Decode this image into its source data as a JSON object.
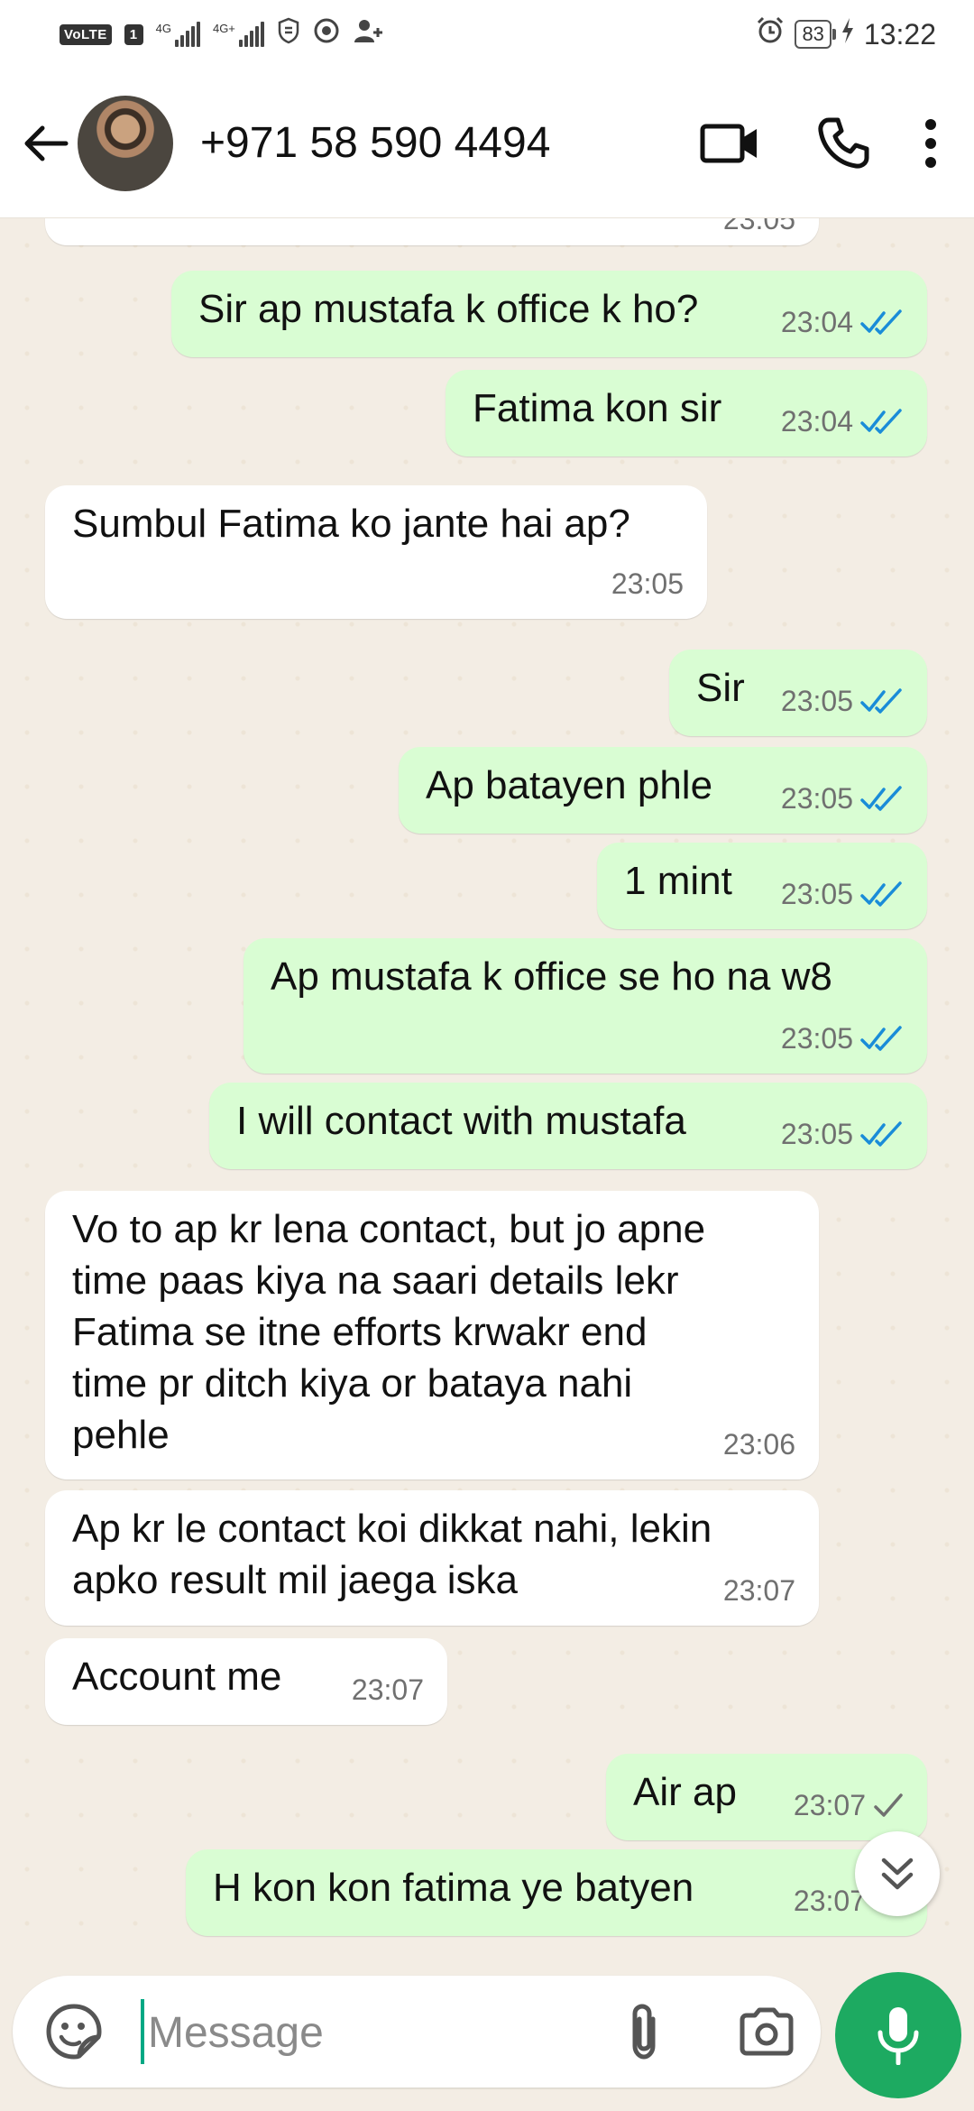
{
  "status_bar": {
    "volte": "VoLTE",
    "sim1_label": "1",
    "net1": "4G",
    "net2": "4G+",
    "battery": "83",
    "time": "13:22"
  },
  "header": {
    "contact": "+971 58 590 4494",
    "icons": [
      "back-arrow-icon",
      "avatar",
      "video-call-icon",
      "phone-icon",
      "more-vert-icon"
    ]
  },
  "messages": [
    {
      "dir": "in",
      "text": "",
      "time": "23:05",
      "status": ""
    },
    {
      "dir": "out",
      "text": "Sir ap mustafa k office k ho?",
      "time": "23:04",
      "status": "read"
    },
    {
      "dir": "out",
      "text": "Fatima kon sir",
      "time": "23:04",
      "status": "read"
    },
    {
      "dir": "in",
      "text": "Sumbul Fatima ko jante hai ap?",
      "time": "23:05",
      "status": ""
    },
    {
      "dir": "out",
      "text": "Sir",
      "time": "23:05",
      "status": "read"
    },
    {
      "dir": "out",
      "text": "Ap batayen phle",
      "time": "23:05",
      "status": "read"
    },
    {
      "dir": "out",
      "text": "1 mint",
      "time": "23:05",
      "status": "read"
    },
    {
      "dir": "out",
      "text": "Ap mustafa k office se ho na w8",
      "time": "23:05",
      "status": "read"
    },
    {
      "dir": "out",
      "text": "I will contact with mustafa",
      "time": "23:05",
      "status": "read"
    },
    {
      "dir": "in",
      "text": "Vo to ap kr lena contact, but jo apne\ntime paas kiya na saari details lekr\nFatima se itne efforts krwakr end\ntime pr ditch kiya or bataya nahi\npehle",
      "time": "23:06",
      "status": ""
    },
    {
      "dir": "in",
      "text": "Ap kr le contact koi dikkat nahi, lekin\napko result mil jaega iska",
      "time": "23:07",
      "status": ""
    },
    {
      "dir": "in",
      "text": "Account me",
      "time": "23:07",
      "status": ""
    },
    {
      "dir": "out",
      "text": "Air ap",
      "time": "23:07",
      "status": "sent"
    },
    {
      "dir": "out",
      "text": "H kon kon fatima ye batyen",
      "time": "23:07",
      "status": "sent"
    }
  ],
  "composer": {
    "placeholder": "Message",
    "value": ""
  },
  "colors": {
    "outgoing_bubble": "#d9fdd3",
    "incoming_bubble": "#ffffff",
    "read_tick": "#1a8cd8",
    "mic_button": "#1daa61",
    "chat_bg": "#f3ede4"
  }
}
